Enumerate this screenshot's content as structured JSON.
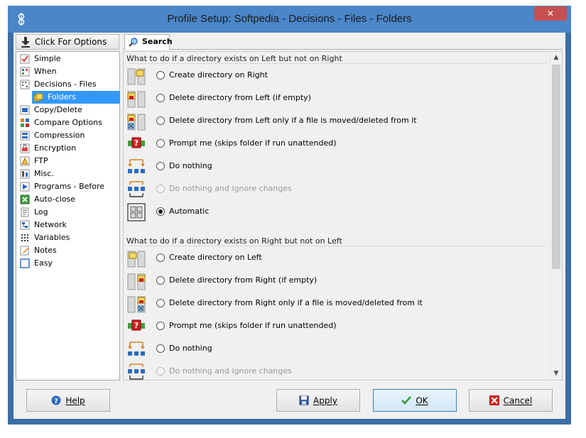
{
  "window": {
    "title": "Profile Setup: Softpedia - Decisions - Files - Folders",
    "close_glyph": "✕"
  },
  "sidebar": {
    "options_button": "Click For Options",
    "items": [
      {
        "label": "Simple",
        "icon": "simple-icon"
      },
      {
        "label": "When",
        "icon": "clock-icon"
      },
      {
        "label": "Decisions - Files",
        "icon": "decisions-icon"
      },
      {
        "label": "Folders",
        "icon": "folders-icon",
        "selected": true
      },
      {
        "label": "Copy/Delete",
        "icon": "copy-delete-icon"
      },
      {
        "label": "Compare Options",
        "icon": "compare-icon"
      },
      {
        "label": "Compression",
        "icon": "compression-icon"
      },
      {
        "label": "Encryption",
        "icon": "encryption-icon"
      },
      {
        "label": "FTP",
        "icon": "ftp-icon"
      },
      {
        "label": "Misc.",
        "icon": "misc-icon"
      },
      {
        "label": "Programs - Before",
        "icon": "programs-icon"
      },
      {
        "label": "Auto-close",
        "icon": "auto-close-icon"
      },
      {
        "label": "Log",
        "icon": "log-icon"
      },
      {
        "label": "Network",
        "icon": "network-icon"
      },
      {
        "label": "Variables",
        "icon": "variables-icon"
      },
      {
        "label": "Notes",
        "icon": "notes-icon"
      },
      {
        "label": "Easy",
        "icon": "easy-icon"
      }
    ]
  },
  "tabs": [
    {
      "label": "Search",
      "icon": "search-icon"
    }
  ],
  "groups": [
    {
      "header": "What to do if a directory exists on Left but not on Right",
      "options": [
        {
          "label": "Create directory on Right",
          "state": "unchecked"
        },
        {
          "label": "Delete directory from Left (if empty)",
          "state": "unchecked"
        },
        {
          "label": "Delete directory from Left only if a file is moved/deleted from it",
          "state": "unchecked"
        },
        {
          "label": "Prompt me (skips folder if run unattended)",
          "state": "unchecked"
        },
        {
          "label": "Do nothing",
          "state": "unchecked"
        },
        {
          "label": "Do nothing and ignore changes",
          "state": "disabled"
        },
        {
          "label": "Automatic",
          "state": "checked"
        }
      ]
    },
    {
      "header": "What to do if a directory exists on Right but not on Left",
      "options": [
        {
          "label": "Create directory on Left",
          "state": "unchecked"
        },
        {
          "label": "Delete directory from Right (if empty)",
          "state": "unchecked"
        },
        {
          "label": "Delete directory from Right only if a file is moved/deleted from it",
          "state": "unchecked"
        },
        {
          "label": "Prompt me (skips folder if run unattended)",
          "state": "unchecked"
        },
        {
          "label": "Do nothing",
          "state": "unchecked"
        },
        {
          "label": "Do nothing and ignore changes",
          "state": "disabled"
        }
      ]
    }
  ],
  "buttons": {
    "help": "Help",
    "apply": "Apply",
    "ok": "OK",
    "cancel": "Cancel"
  },
  "colors": {
    "title_bar": "#4a86c8",
    "selection": "#3399ff",
    "close": "#c75050"
  }
}
